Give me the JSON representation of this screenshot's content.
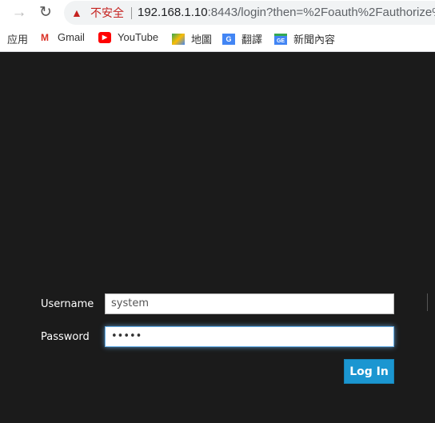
{
  "browser": {
    "forward_icon": "arrow-right",
    "reload_icon": "reload",
    "security_label": "不安全",
    "url_host": "192.168.1.10",
    "url_rest": ":8443/login?then=%2Foauth%2Fauthorize%"
  },
  "bookmarks": [
    {
      "label": "应用",
      "icon": "apps"
    },
    {
      "label": "Gmail",
      "icon": "gmail"
    },
    {
      "label": "YouTube",
      "icon": "youtube"
    },
    {
      "label": "地圖",
      "icon": "maps"
    },
    {
      "label": "翻譯",
      "icon": "translate"
    },
    {
      "label": "新聞內容",
      "icon": "news"
    }
  ],
  "form": {
    "username_label": "Username",
    "username_value": "system",
    "password_label": "Password",
    "password_value": "•••••",
    "login_label": "Log In"
  },
  "colors": {
    "background": "#1b1b1b",
    "button": "#1b96d1",
    "warning": "#c5221f"
  }
}
